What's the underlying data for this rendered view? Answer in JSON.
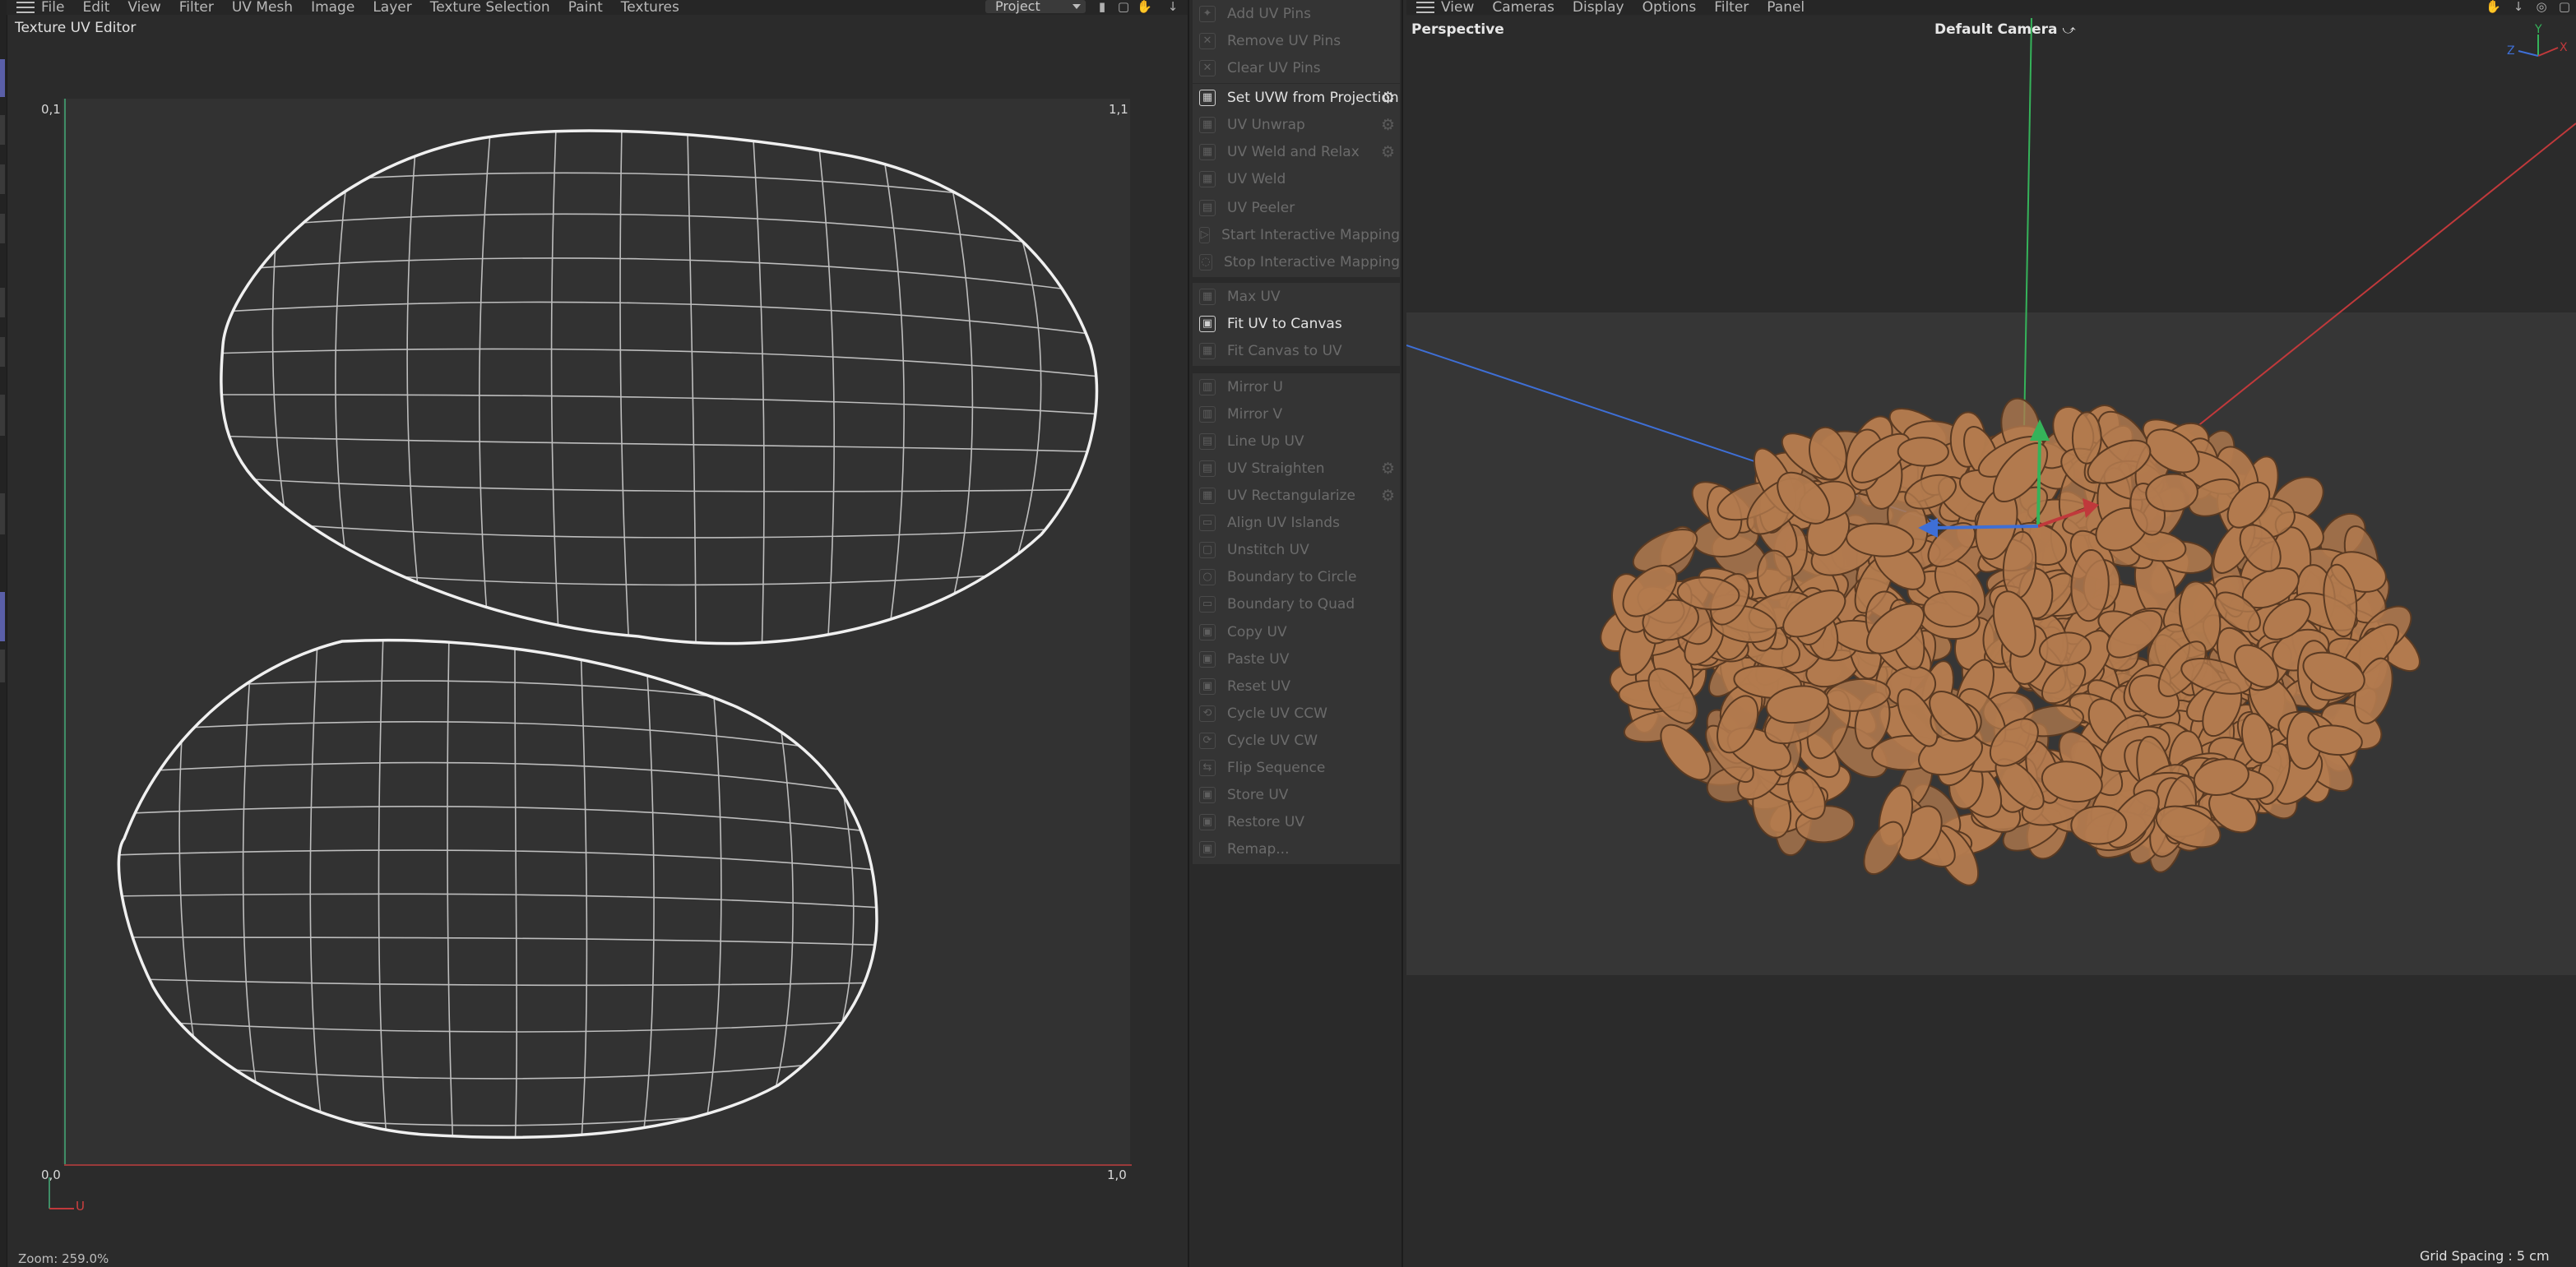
{
  "uv_editor": {
    "menu": [
      "File",
      "Edit",
      "View",
      "Filter",
      "UV Mesh",
      "Image",
      "Layer",
      "Texture Selection",
      "Paint",
      "Textures"
    ],
    "title": "Texture UV Editor",
    "project_select": "Project",
    "corner_top_left": "0,1",
    "corner_top_right": "1,1",
    "corner_bottom_left": "0,0",
    "corner_bottom_right": "1,0",
    "axis_u_label": "U",
    "zoom": "Zoom: 259.0%"
  },
  "commands": {
    "groups": [
      [
        {
          "label": "Add UV Pins",
          "enabled": false,
          "gear": false
        },
        {
          "label": "Remove UV Pins",
          "enabled": false,
          "gear": false
        },
        {
          "label": "Clear UV Pins",
          "enabled": false,
          "gear": false
        }
      ],
      [
        {
          "label": "Set UVW from Projection",
          "enabled": true,
          "gear": true
        },
        {
          "label": "UV Unwrap",
          "enabled": false,
          "gear": true
        },
        {
          "label": "UV Weld and Relax",
          "enabled": false,
          "gear": true
        },
        {
          "label": "UV Weld",
          "enabled": false,
          "gear": false
        }
      ],
      [
        {
          "label": "UV Peeler",
          "enabled": false,
          "gear": false
        },
        {
          "label": "Start Interactive Mapping",
          "enabled": false,
          "gear": false
        },
        {
          "label": "Stop Interactive Mapping",
          "enabled": false,
          "gear": false
        }
      ],
      [
        {
          "label": "Max UV",
          "enabled": false,
          "gear": false
        },
        {
          "label": "Fit UV to Canvas",
          "enabled": true,
          "gear": false
        },
        {
          "label": "Fit Canvas to UV",
          "enabled": false,
          "gear": false
        }
      ],
      [
        {
          "label": "Mirror U",
          "enabled": false,
          "gear": false
        },
        {
          "label": "Mirror V",
          "enabled": false,
          "gear": false
        },
        {
          "label": "Line Up UV",
          "enabled": false,
          "gear": false
        },
        {
          "label": "UV Straighten",
          "enabled": false,
          "gear": true
        },
        {
          "label": "UV Rectangularize",
          "enabled": false,
          "gear": true
        },
        {
          "label": "Align UV Islands",
          "enabled": false,
          "gear": false
        },
        {
          "label": "Unstitch UV",
          "enabled": false,
          "gear": false
        },
        {
          "label": "Boundary to Circle",
          "enabled": false,
          "gear": false
        },
        {
          "label": "Boundary to Quad",
          "enabled": false,
          "gear": false
        }
      ],
      [
        {
          "label": "Copy UV",
          "enabled": false,
          "gear": false
        },
        {
          "label": "Paste UV",
          "enabled": false,
          "gear": false
        },
        {
          "label": "Reset UV",
          "enabled": false,
          "gear": false
        },
        {
          "label": "Cycle UV CCW",
          "enabled": false,
          "gear": false
        },
        {
          "label": "Cycle UV CW",
          "enabled": false,
          "gear": false
        },
        {
          "label": "Flip Sequence",
          "enabled": false,
          "gear": false
        },
        {
          "label": "Store UV",
          "enabled": false,
          "gear": false
        },
        {
          "label": "Restore UV",
          "enabled": false,
          "gear": false
        },
        {
          "label": "Remap...",
          "enabled": false,
          "gear": false
        }
      ]
    ]
  },
  "viewport": {
    "menu": [
      "View",
      "Cameras",
      "Display",
      "Options",
      "Filter",
      "Panel"
    ],
    "view_name": "Perspective",
    "camera": "Default Camera",
    "grid_spacing": "Grid Spacing : 5 cm",
    "axis_labels": {
      "x": "X",
      "y": "Y",
      "z": "Z"
    },
    "colors": {
      "x_axis": "#c0393b",
      "y_axis": "#35b35a",
      "z_axis": "#3e6fd6",
      "bean": "#b27a4e"
    }
  }
}
